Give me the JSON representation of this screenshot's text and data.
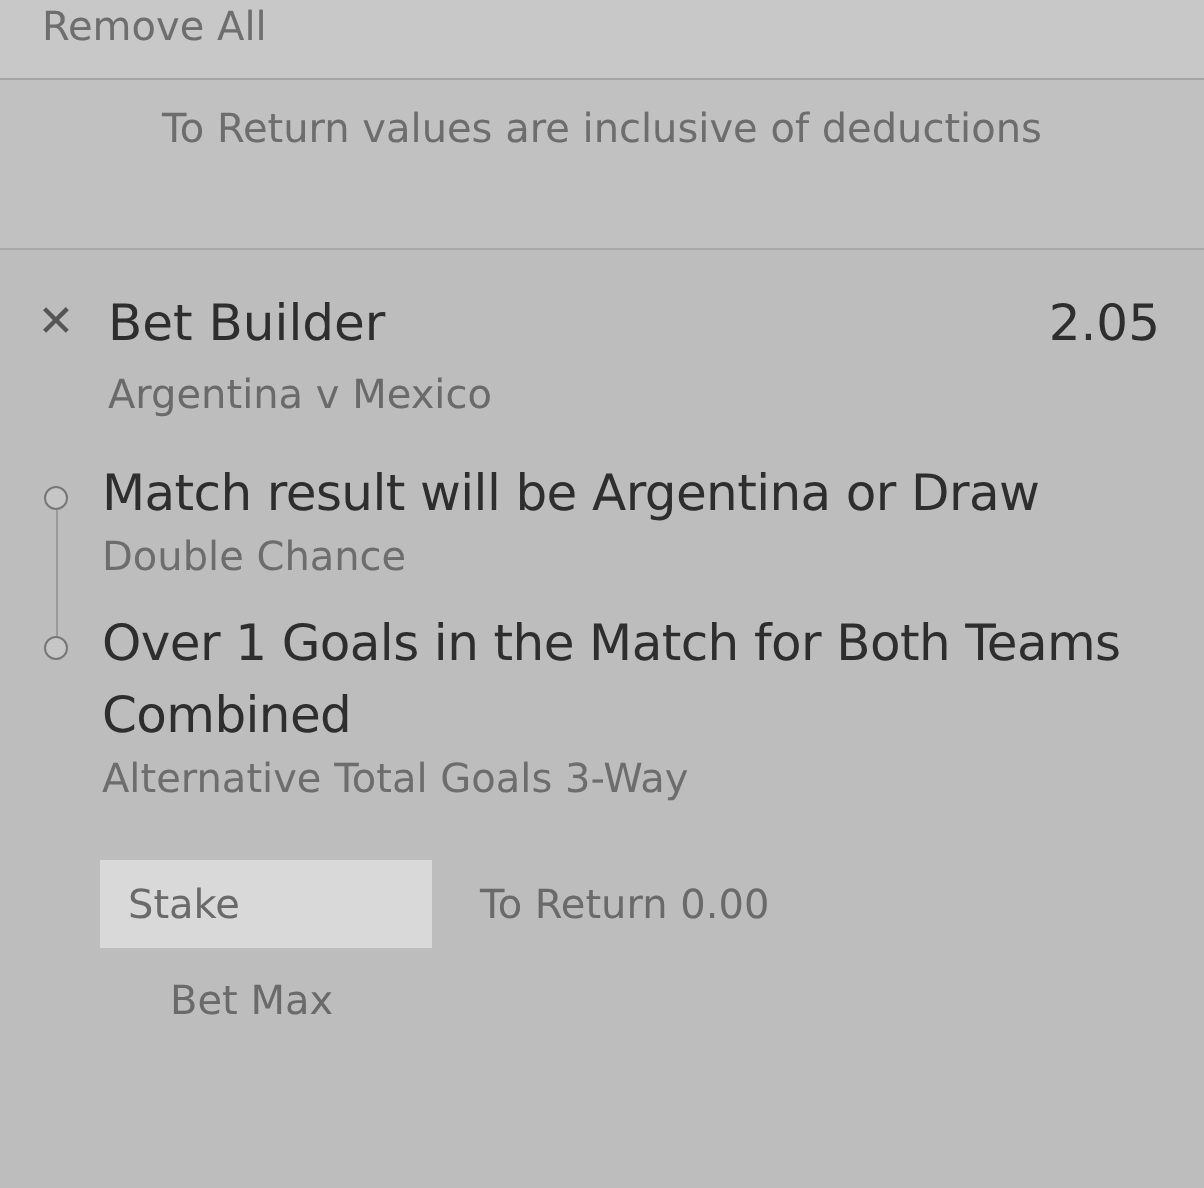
{
  "remove_all": {
    "label": "Remove All"
  },
  "notice": "To Return values are inclusive of deductions",
  "bet": {
    "close_icon": "✕",
    "title": "Bet Builder",
    "odds": "2.05",
    "event": "Argentina v Mexico",
    "selections": [
      {
        "name": "Match result will be Argentina or Draw",
        "market": "Double Chance"
      },
      {
        "name": "Over 1 Goals in the Match for Both Teams Combined",
        "market": "Alternative Total Goals 3-Way"
      }
    ],
    "stake": {
      "placeholder": "Stake"
    },
    "to_return": "To Return 0.00",
    "bet_max": "Bet Max"
  }
}
